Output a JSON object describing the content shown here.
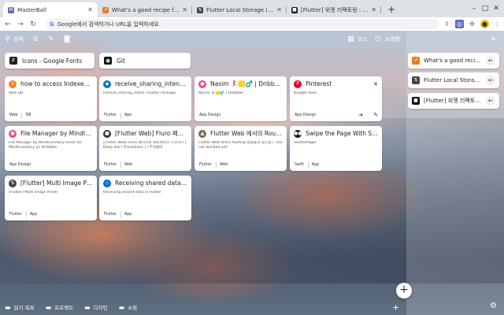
{
  "browser": {
    "tabs": [
      {
        "title": "MasterBall",
        "active": true,
        "icon": "masterball-icon",
        "color": "#5c6bc0",
        "glyph": "M"
      },
      {
        "title": "What's a good recipe for overn",
        "active": false,
        "icon": "paw-icon",
        "color": "#e67e22",
        "glyph": "↗"
      },
      {
        "title": "Flutter Local Storage (SQLite)",
        "active": false,
        "icon": "sort-icon",
        "color": "#444",
        "glyph": "⇅"
      },
      {
        "title": "[Flutter] 위젯 리팩토링 : 긴 위젯 코",
        "active": false,
        "icon": "velog-icon",
        "color": "#111",
        "glyph": "■"
      }
    ],
    "new_tab": "+",
    "address_placeholder": "Google에서 검색하거나 URL을 입력하세요.",
    "address_prefix": "G"
  },
  "topbar": {
    "search_label": "검색",
    "board_label": "보드",
    "archive_label": "보관함"
  },
  "row0": [
    {
      "title": "Icons - Google Fonts",
      "icon": "google-fonts-icon",
      "color": "#222",
      "glyph": "F"
    },
    {
      "title": "Git",
      "icon": "github-icon",
      "color": "#111",
      "glyph": "◉"
    }
  ],
  "cards": [
    {
      "title": "how to access IndexedDB (of c",
      "icon": "stackoverflow-icon",
      "color": "#f48024",
      "glyph": "S",
      "desc": "Web DB",
      "tags": [
        "Web",
        "DB"
      ],
      "actions": false
    },
    {
      "title": "receive_sharing_intent | Flutt",
      "icon": "flutter-dart-icon",
      "color": "#0175c2",
      "glyph": "◆",
      "desc": "receive_sharing_intent | Flutter Package",
      "tags": [
        "Flutter",
        "App"
      ],
      "actions": false
    },
    {
      "title": "Nasim 🏃‍♀️🟨♂️ | Dribbble",
      "icon": "dribbble-icon",
      "color": "#ea4c89",
      "glyph": "●",
      "desc": "Nasim 🏃‍♀️🟨♂️ | Dribbble",
      "tags": [
        "App Design"
      ],
      "actions": false
    },
    {
      "title": "Pinterest",
      "icon": "pinterest-icon",
      "color": "#e60023",
      "glyph": "P",
      "desc": "Budget View",
      "tags": [
        "App Design"
      ],
      "actions": true
    },
    {
      "title": "File Manager by MindInventor",
      "icon": "dribbble-icon",
      "color": "#ea4c89",
      "glyph": "●",
      "desc": "File Manager by MindInventory UI/UX for MindInventory on Dribbble",
      "tags": [
        "App Design"
      ],
      "actions": false
    },
    {
      "title": "[Flutter Web] Fluro 패키지로 네",
      "icon": "velog-icon",
      "color": "#333",
      "glyph": "■",
      "desc": "[Flutter Web] Fluro 패키지로 네비게이션 구현하기 ( Deep link / Transitions ) | 무엇을비",
      "tags": [
        "Flutter",
        "Web"
      ],
      "actions": false
    },
    {
      "title": "Flutter Web 에서의 Routing 방",
      "icon": "blog-icon",
      "color": "#7a6a55",
      "glyph": "▲",
      "desc": "Flutter Web 에서의 Routing 방법들과 장단점 | Titis not decided yet!",
      "tags": [
        "Flutter",
        "Web"
      ],
      "actions": false
    },
    {
      "title": "Swipe the Page With SwiftUIF",
      "icon": "medium-icon",
      "color": "#111",
      "glyph": "●●",
      "desc": "SwiftUIPager",
      "tags": [
        "Swift",
        "App"
      ],
      "actions": false
    },
    {
      "title": "[Flutter] Multi Image Picker",
      "icon": "sort-icon",
      "color": "#444",
      "glyph": "⇅",
      "desc": "[Flutter] Multi Image Picker",
      "tags": [
        "Flutter",
        "App"
      ],
      "actions": false
    },
    {
      "title": "Receiving shared data in Flutte",
      "icon": "flutter-icon",
      "color": "#0468d7",
      "glyph": "◇",
      "desc": "Receiving shared data in Flutter",
      "tags": [
        "Flutter",
        "App"
      ],
      "actions": false
    }
  ],
  "sidebar": [
    {
      "title": "What's a good recipe for over",
      "icon": "paw-icon",
      "color": "#e67e22",
      "glyph": "↗"
    },
    {
      "title": "Flutter Local Storage (SQLite",
      "icon": "sort-icon",
      "color": "#444",
      "glyph": "⇅"
    },
    {
      "title": "[Flutter] 위젯 리팩토링 : 긴",
      "icon": "velog-icon",
      "color": "#111",
      "glyph": "■"
    }
  ],
  "bottombar": {
    "folders": [
      "읽기 목록",
      "프로젝트",
      "디자인",
      "쇼핑"
    ],
    "add": "+"
  },
  "fab": "+"
}
